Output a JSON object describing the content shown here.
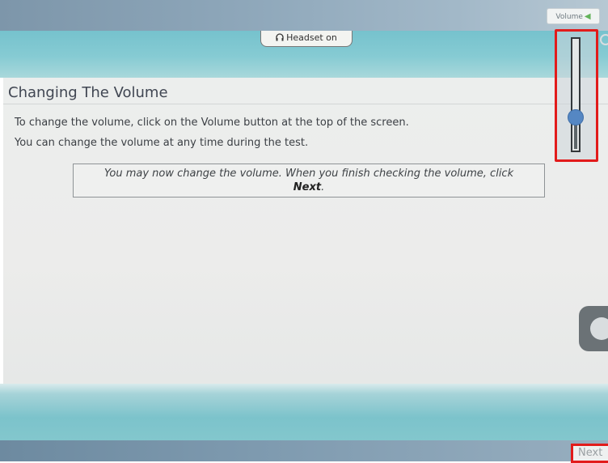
{
  "toolbar": {
    "volume_label": "Volume",
    "volume_icon": "speaker-icon",
    "headset_label": "Headset on",
    "headset_icon": "headphones-icon"
  },
  "page": {
    "title": "Changing The Volume",
    "paragraphs": [
      "To change the volume, click on the Volume button at the top of the screen.",
      "You can change the volume at any time during the test."
    ],
    "callout_text": "You may now change the volume. When you finish checking the volume, click",
    "callout_emphasis": "Next",
    "callout_end": "."
  },
  "volume_slider": {
    "level": 0.3
  },
  "footer": {
    "next_label": "Next"
  },
  "colors": {
    "highlight": "#e21b1b",
    "banner": "#86cbd3",
    "knob": "#5587c3"
  }
}
